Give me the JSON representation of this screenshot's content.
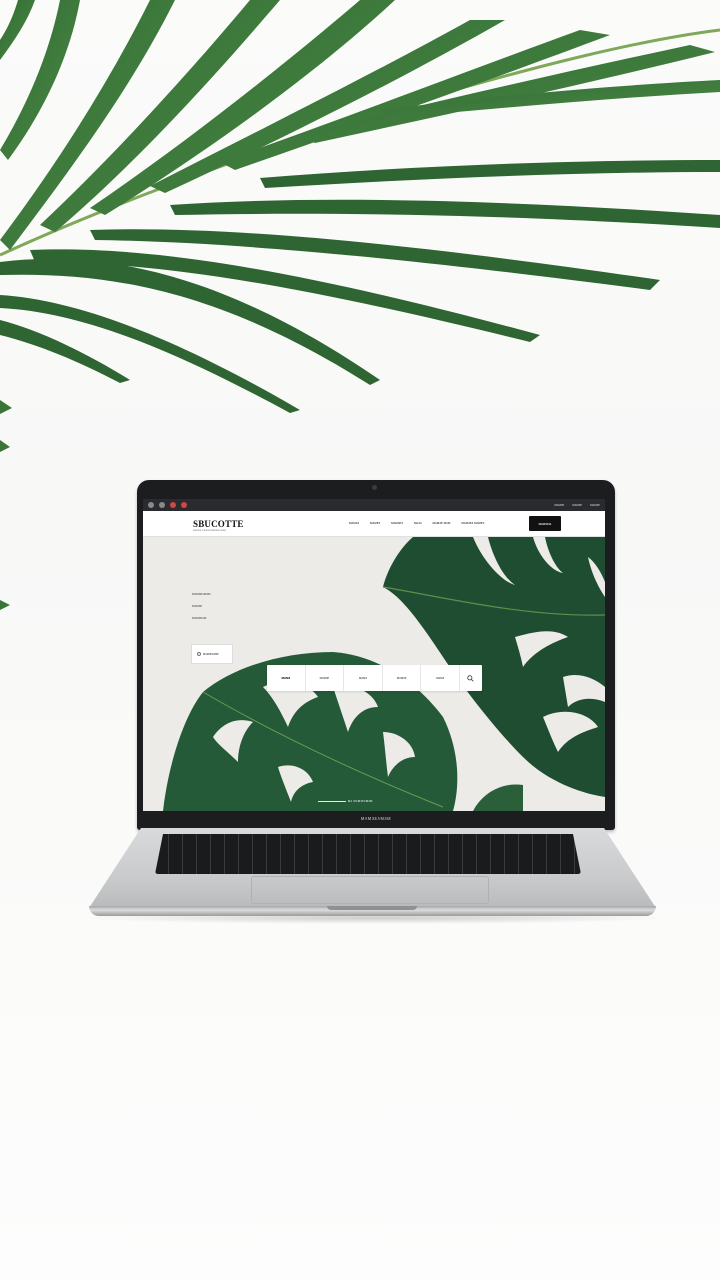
{
  "site": {
    "logo": "SBUCOTTE",
    "logo_sub": "ᴈᴍʀᴈᴍ ᴇᴍᴍᴈᴀᴍᴍᴇᴇᴍᴀᴍᴍᴈ",
    "nav_links": [
      "ᴍᴀᴍᴈᴈ",
      "ᴍᴀᴍᴇᴈ",
      "ᴍᴀᴍᴈᴇᴈ",
      "ᴍᴀᴈᴈ",
      "ᴍᴀᴍᴈᴇ ᴍᴀᴍ",
      "ᴍᴀᴍᴈᴇᴈ ᴍᴀᴍᴇᴈ"
    ],
    "nav_cta": "ᴍᴀᴍᴈᴈᴈᴀ",
    "hero_lines": [
      "ᴍᴀᴍᴈᴇᴀᴍᴈᴍ",
      "ᴍᴀᴍᴈᴇ",
      "ᴍᴀᴍᴈᴇᴀᴍ"
    ],
    "hero_button": "ᴍᴀᴍᴈᴇᴀᴍᴈᴇ",
    "search_fields": [
      "ᴍᴀᴍᴈ",
      "ᴍᴀᴍᴈᴇ",
      "ᴍᴀᴍᴈ",
      "ᴍᴀᴍᴈᴇ",
      "ᴍᴀᴍᴈ"
    ],
    "caption": "ᴍᴀ ᴍᴀᴍᴈᴇᴀᴍᴈᴍ"
  },
  "browser": {
    "right_items": [
      "ᴍᴀᴍᴈᴇ",
      "ᴍᴀᴍᴈᴇ",
      "ᴍᴀᴍᴈᴇ"
    ]
  },
  "laptop": {
    "bezel_text": "ᴍᴀᴍᴈᴇᴀᴍᴈᴍ"
  },
  "colors": {
    "leaf_dark": "#1f4d32",
    "leaf_mid": "#2f6a43",
    "frond": "#3f7a3c",
    "background": "#fbfbfa"
  }
}
